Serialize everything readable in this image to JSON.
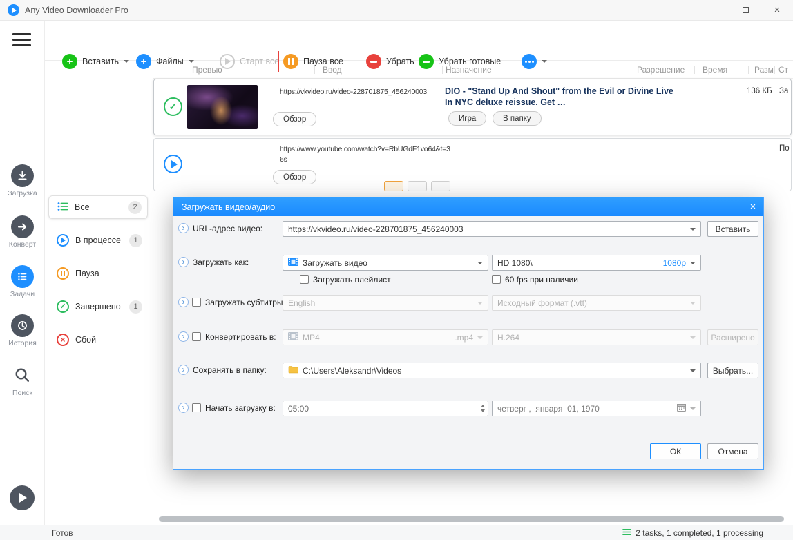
{
  "titlebar": {
    "title": "Any Video Downloader Pro"
  },
  "colors": {
    "accent_blue": "#1e8fff",
    "green": "#17c317",
    "orange": "#f59a23",
    "red": "#e8413c",
    "success": "#2dbd5f"
  },
  "toolbar": {
    "paste": "Вставить",
    "files": "Файлы",
    "start_all": "Старт все",
    "pause_all": "Пауза все",
    "remove": "Убрать",
    "remove_completed": "Убрать готовые"
  },
  "sidebar": {
    "items": [
      {
        "label": "Загрузка"
      },
      {
        "label": "Конверт"
      },
      {
        "label": "Задачи"
      },
      {
        "label": "История"
      },
      {
        "label": "Поиск"
      }
    ]
  },
  "filters": [
    {
      "label": "Все",
      "badge": "2"
    },
    {
      "label": "В процессе",
      "badge": "1"
    },
    {
      "label": "Пауза"
    },
    {
      "label": "Завершено",
      "badge": "1"
    },
    {
      "label": "Сбой"
    }
  ],
  "table": {
    "headers": [
      "Превью",
      "Ввод",
      "Назначение",
      "Разрешение",
      "Время",
      "Разм",
      "Ст"
    ],
    "rows": [
      {
        "url": "https://vkvideo.ru/video-228701875_456240003",
        "browse": "Обзор",
        "title": "DIO - \"Stand Up And Shout\" from the Evil or Divine Live In NYC deluxe reissue. Get …",
        "tag1": "Игра",
        "tag2": "В папку",
        "size": "136 КБ",
        "status": "За"
      },
      {
        "url": "https://www.youtube.com/watch?v=RbUGdF1vo64&t=36s",
        "browse": "Обзор",
        "status": "По"
      }
    ]
  },
  "dialog": {
    "title": "Загружать видео/аудио",
    "rows": {
      "url": {
        "label": "URL-адрес видео:",
        "value": "https://vkvideo.ru/video-228701875_456240003",
        "button": "Вставить"
      },
      "download_as": {
        "label": "Загружать как:",
        "value": "Загружать видео",
        "quality": "HD 1080\\",
        "quality_badge": "1080p"
      },
      "options": {
        "playlist": "Загружать плейлист",
        "fps": "60 fps при наличии"
      },
      "subtitles": {
        "label": "Загружать субтитры:",
        "language": "English",
        "format": "Исходный формат (.vtt)"
      },
      "convert": {
        "label": "Конвертировать в:",
        "format": "MP4",
        "ext": ".mp4",
        "codec": "H.264",
        "button": "Расширено"
      },
      "save": {
        "label": "Сохранять в папку:",
        "path": "C:\\Users\\Aleksandr\\Videos",
        "button": "Выбрать..."
      },
      "schedule": {
        "label": "Начать загрузку в:",
        "time": "05:00",
        "date": "четверг ,  января  01, 1970"
      }
    },
    "ok": "ОК",
    "cancel": "Отмена"
  },
  "statusbar": {
    "ready": "Готов",
    "tasks": "2 tasks, 1 completed, 1 processing"
  }
}
